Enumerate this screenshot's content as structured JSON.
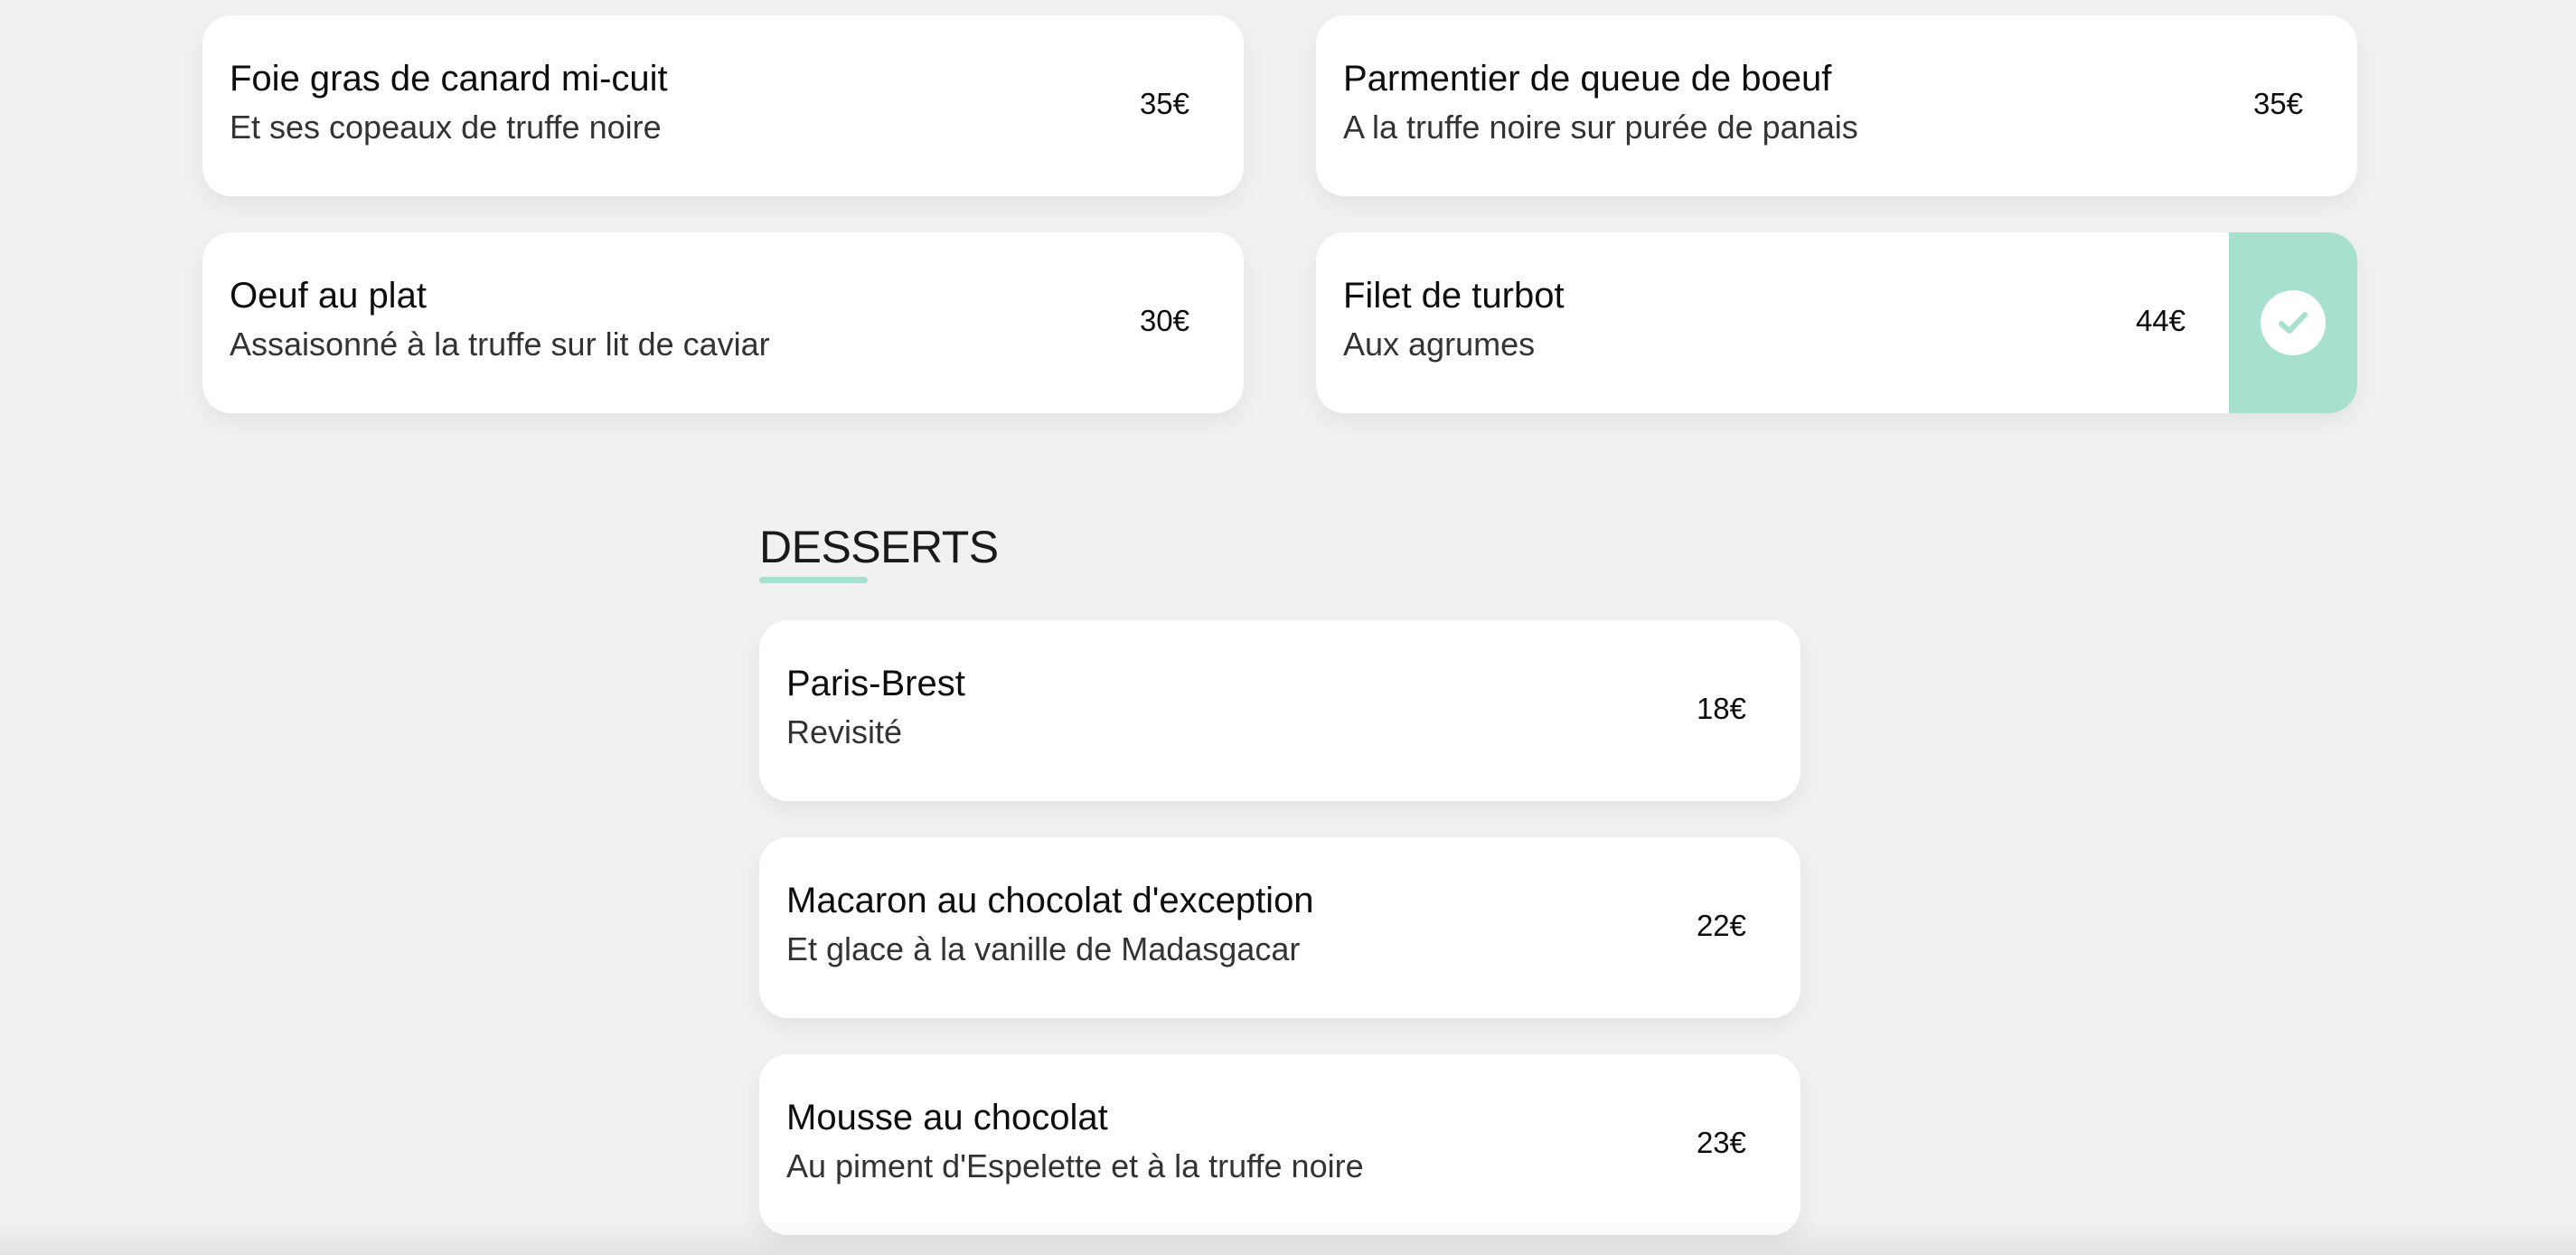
{
  "mains": [
    {
      "name": "Foie gras de canard mi-cuit",
      "description": "Et ses copeaux de truffe noire",
      "price": "35€"
    },
    {
      "name": "Parmentier de queue de boeuf",
      "description": "A la truffe noire sur purée de panais",
      "price": "35€"
    },
    {
      "name": "Oeuf au plat",
      "description": "Assaisonné à la truffe sur lit de caviar",
      "price": "30€"
    },
    {
      "name": "Filet de turbot",
      "description": "Aux agrumes",
      "price": "44€",
      "selected": true
    }
  ],
  "desserts": {
    "title": "DESSERTS",
    "items": [
      {
        "name": "Paris-Brest",
        "description": "Revisité",
        "price": "18€"
      },
      {
        "name": "Macaron au chocolat d'exception",
        "description": "Et glace à la vanille de Madasgacar",
        "price": "22€"
      },
      {
        "name": "Mousse au chocolat",
        "description": "Au piment d'Espelette et à la truffe noire",
        "price": "23€"
      }
    ]
  },
  "icons": {
    "check": "check-icon"
  },
  "colors": {
    "accent": "#a7e0cf",
    "background": "#f1f1f1",
    "card": "#ffffff"
  }
}
